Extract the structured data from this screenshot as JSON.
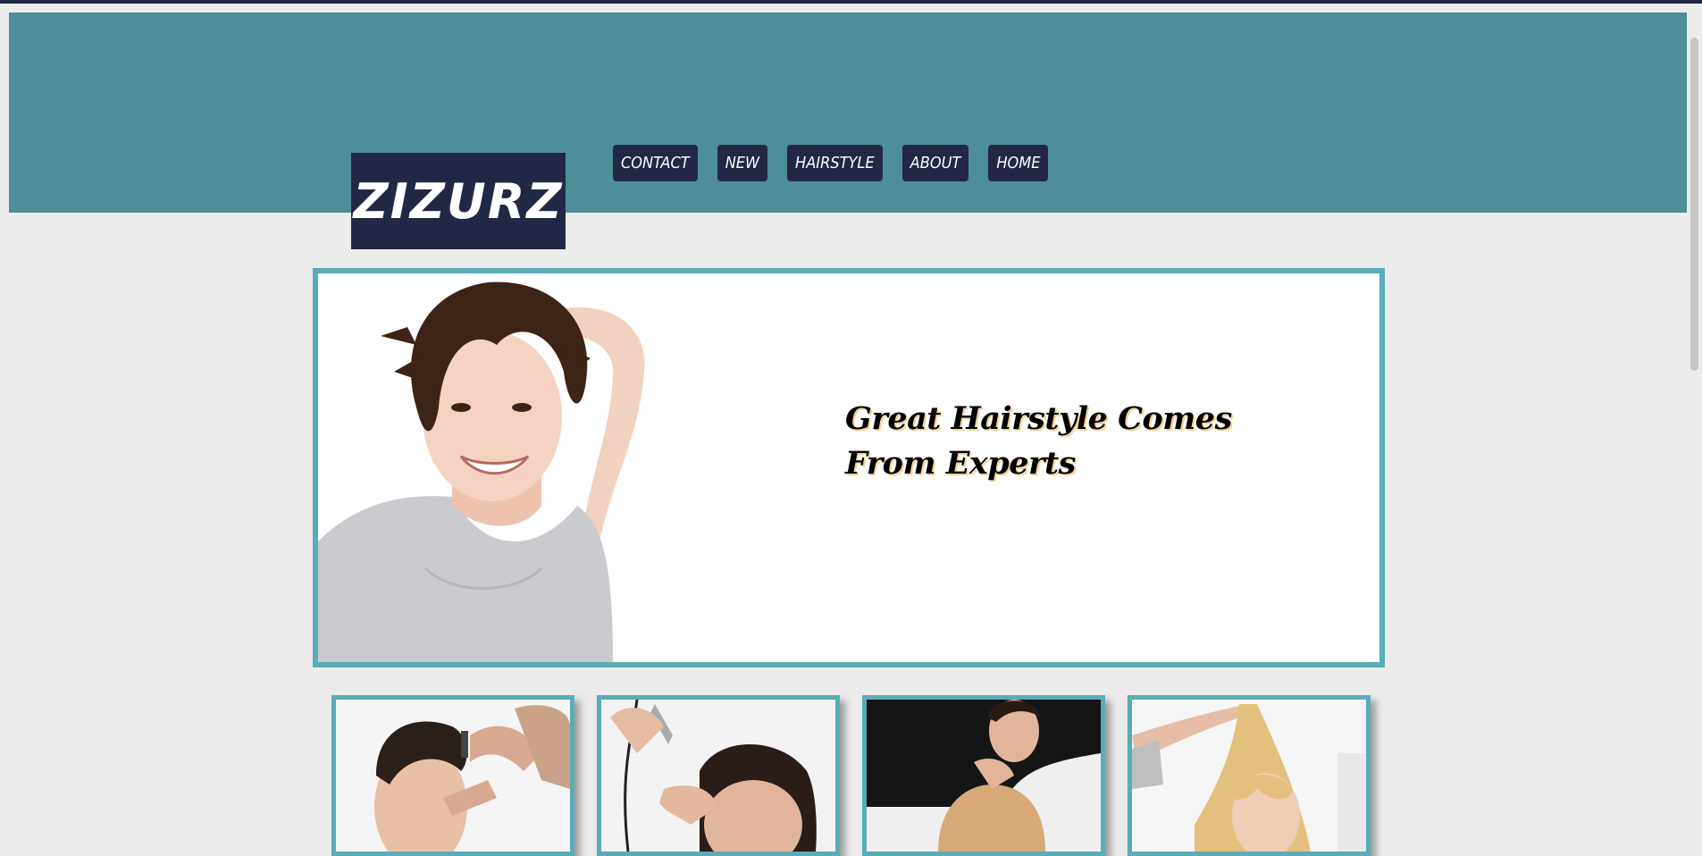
{
  "logo": {
    "text": "ZIZURZ"
  },
  "nav": {
    "items": [
      "CONTACT",
      "NEW",
      "HAIRSTYLE",
      "ABOUT",
      "HOME"
    ]
  },
  "hero": {
    "line1": "Great Hairstyle Comes",
    "line2": "From Experts"
  },
  "colors": {
    "header": "#4d8e97",
    "logo_bg": "#222844",
    "frame": "#5aacb8",
    "page_bg": "#ececec"
  }
}
